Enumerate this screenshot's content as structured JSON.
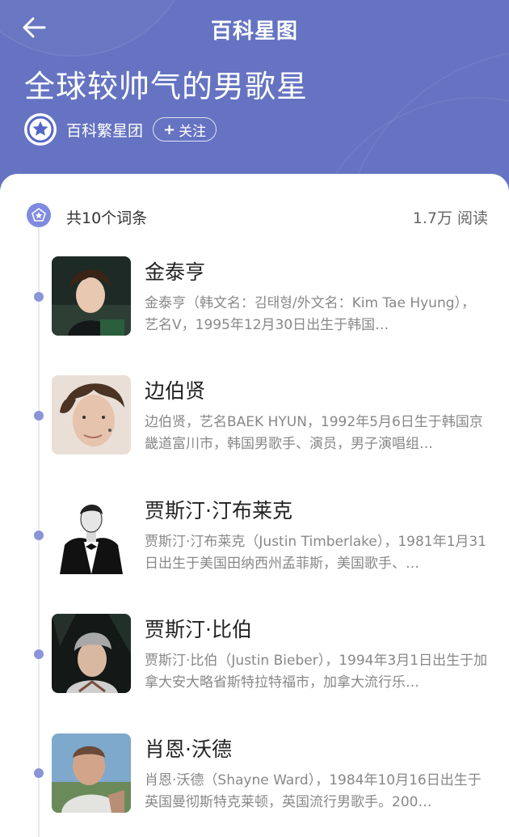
{
  "topbar": {
    "title": "百科星图"
  },
  "page": {
    "title": "全球较帅气的男歌星"
  },
  "org": {
    "name": "百科繁星团",
    "follow_label": "关注",
    "follow_plus": "+"
  },
  "summary": {
    "count": "共10个词条",
    "reads": "1.7万 阅读"
  },
  "entries": [
    {
      "name": "金泰亨",
      "desc": "金泰亨（韩文名：김태형/外文名：Kim Tae Hyung），艺名V，1995年12月30日出生于韩国…"
    },
    {
      "name": "边伯贤",
      "desc": "边伯贤，艺名BAEK HYUN，1992年5月6日生于韩国京畿道富川市，韩国男歌手、演员，男子演唱组…"
    },
    {
      "name": "贾斯汀·汀布莱克",
      "desc": "贾斯汀·汀布莱克（Justin Timberlake），1981年1月31日出生于美国田纳西州孟菲斯，美国歌手、…"
    },
    {
      "name": "贾斯汀·比伯",
      "desc": "贾斯汀·比伯（Justin Bieber），1994年3月1日出生于加拿大安大略省斯特拉特福市，加拿大流行乐…"
    },
    {
      "name": "肖恩·沃德",
      "desc": "肖恩·沃德（Shayne Ward），1984年10月16日出生于英国曼彻斯特克莱顿，英国流行男歌手。200…"
    }
  ],
  "colors": {
    "header_bg": "#6573c2",
    "accent": "#8a95d8"
  }
}
